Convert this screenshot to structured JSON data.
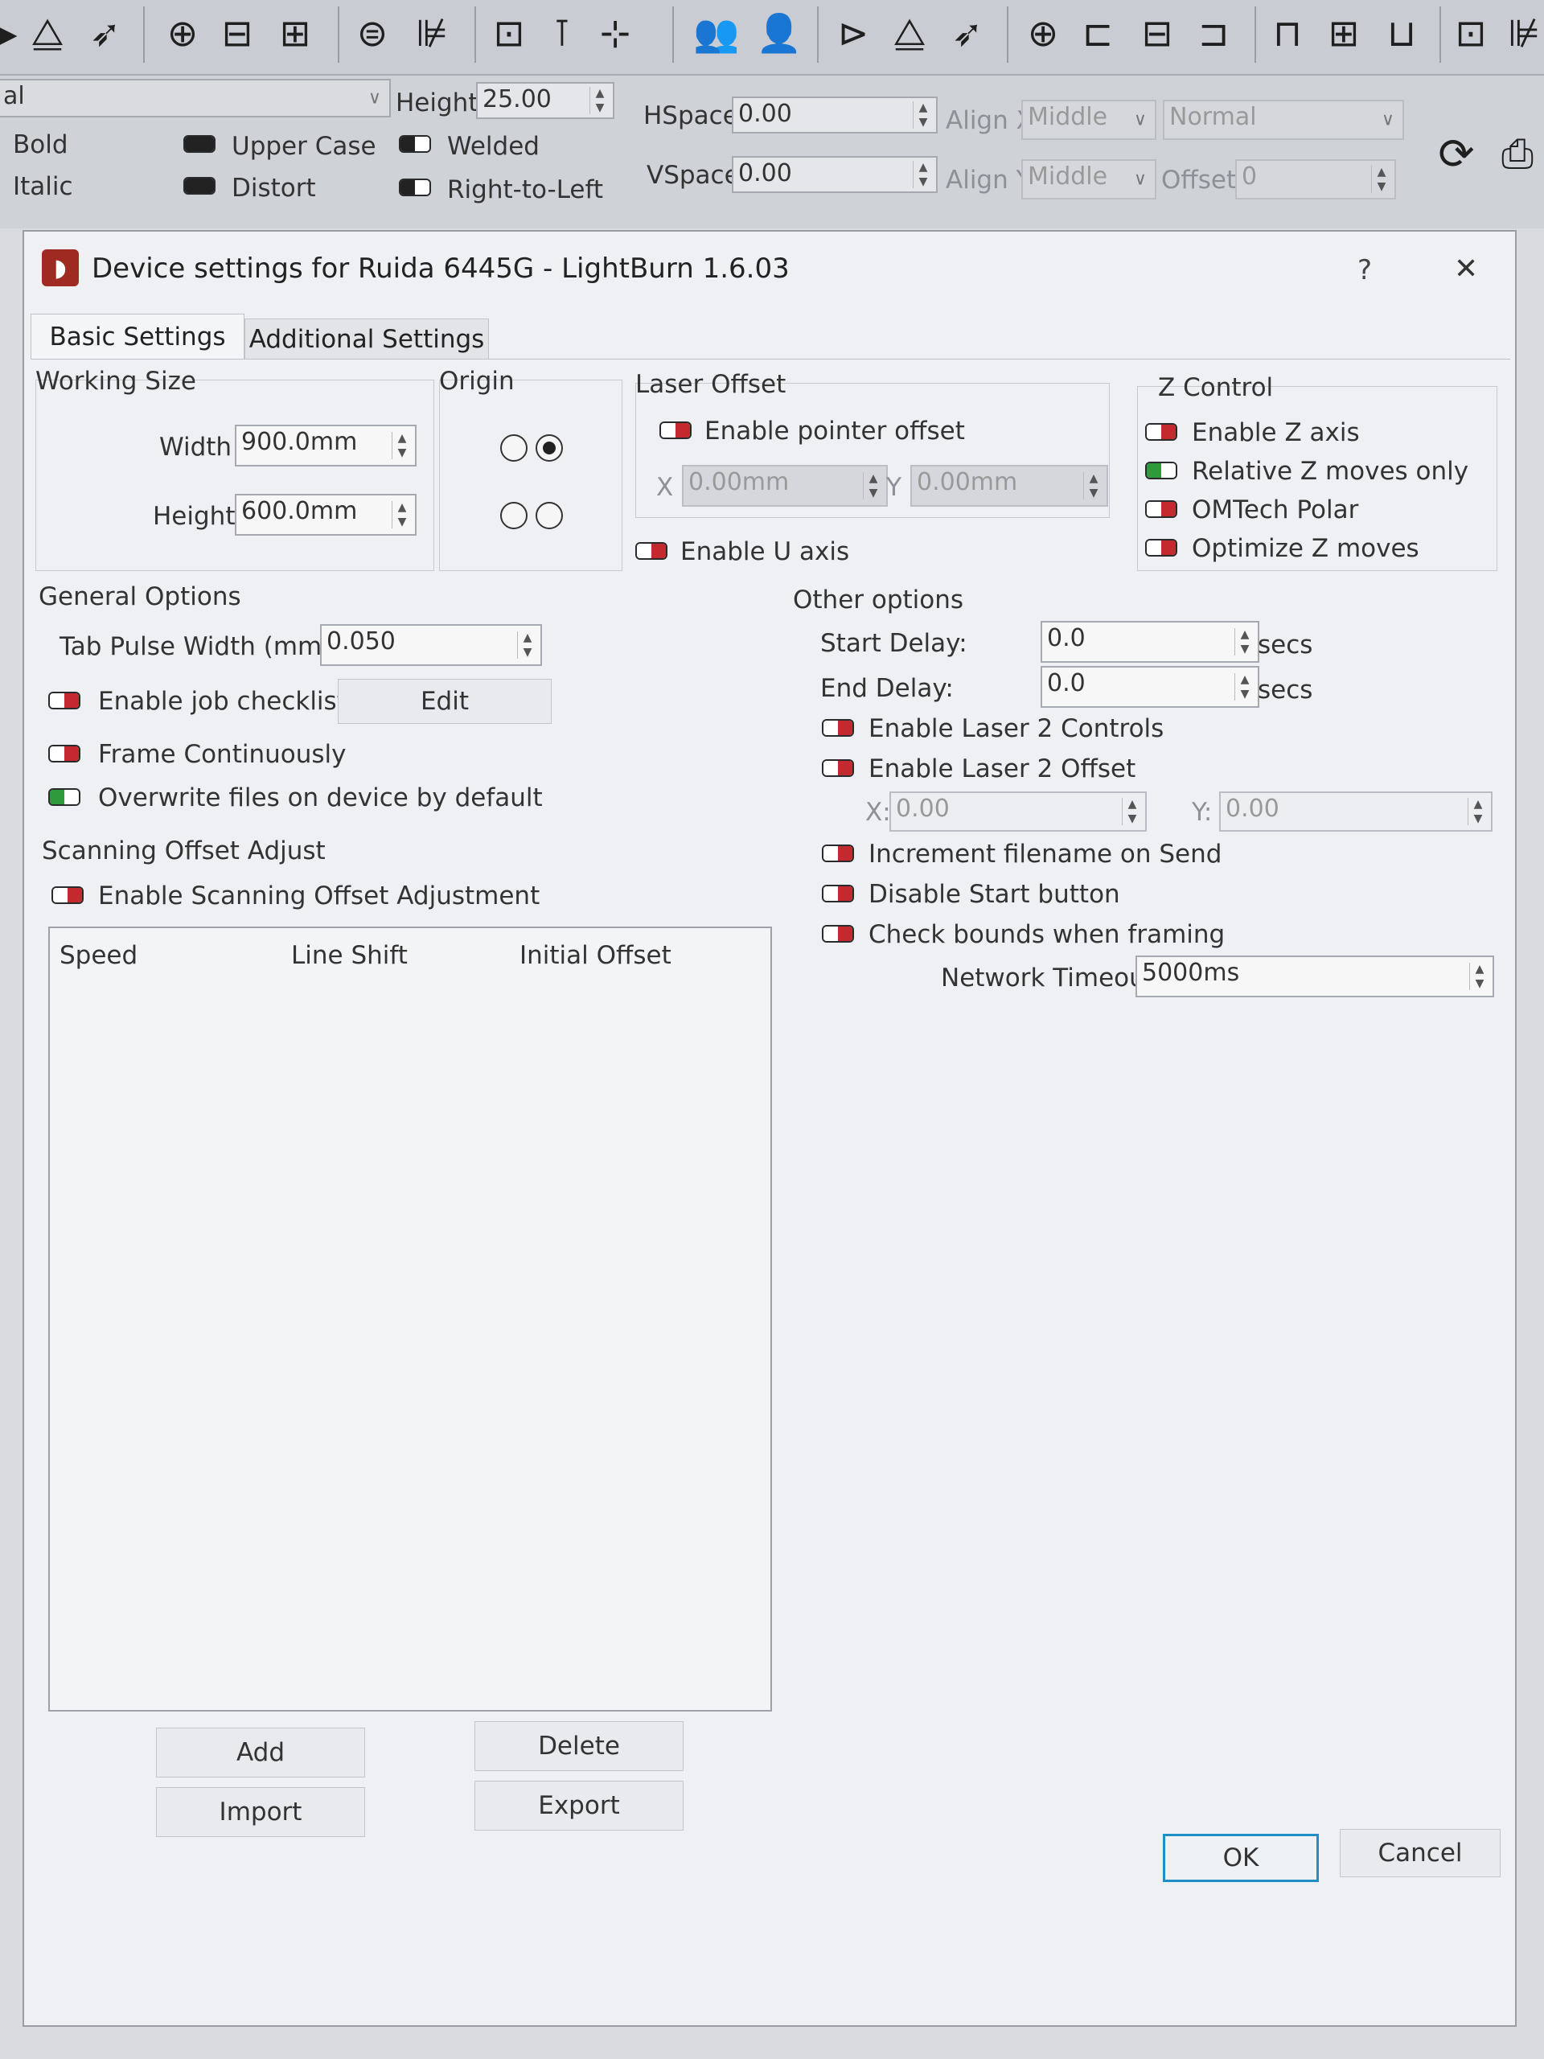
{
  "toolbar": {
    "icons": [
      "mirror-icon",
      "move-laser-icon",
      "target-icon",
      "align-centers-icon",
      "distribute-icon",
      "align-vertical-icon",
      "distribute-horizontal-icon",
      "group-icon",
      "distribute-spacing-icon",
      "add-node-icon",
      "users-icon",
      "user-icon",
      "arrow-right-icon",
      "mirror-icon",
      "move-laser-icon",
      "target-icon",
      "align-left-icon",
      "align-centers-icon",
      "align-right-icon",
      "align-top-icon",
      "align-middle-icon",
      "align-bottom-icon",
      "group-icon",
      "distribute-icon",
      "rotate-icon",
      "machine-icon"
    ]
  },
  "text_toolbar": {
    "font_partial": "al",
    "height_label": "Height",
    "height_value": "25.00",
    "hspace_label": "HSpace",
    "hspace_value": "0.00",
    "vspace_label": "VSpace",
    "vspace_value": "0.00",
    "align_x_label": "Align X",
    "align_x_value": "Middle",
    "align_y_label": "Align Y",
    "align_y_value": "Middle",
    "mode_value": "Normal",
    "offset_label": "Offset",
    "offset_value": "0",
    "bold": "Bold",
    "italic": "Italic",
    "upper_case": "Upper Case",
    "distort": "Distort",
    "welded": "Welded",
    "right_to_left": "Right-to-Left"
  },
  "dialog": {
    "title": "Device settings for Ruida 6445G - LightBurn 1.6.03",
    "help": "?",
    "close": "✕",
    "tabs": [
      "Basic Settings",
      "Additional Settings"
    ],
    "working_size": {
      "title": "Working Size",
      "width_label": "Width",
      "width_value": "900.0mm",
      "height_label": "Height",
      "height_value": "600.0mm"
    },
    "origin": {
      "title": "Origin",
      "selected": "top-right"
    },
    "laser_offset": {
      "title": "Laser Offset",
      "enable_pointer": "Enable pointer offset",
      "x_label": "X",
      "x_value": "0.00mm",
      "y_label": "Y",
      "y_value": "0.00mm",
      "enable_u_axis": "Enable U axis"
    },
    "z_control": {
      "title": "Z Control",
      "enable_z": "Enable Z axis",
      "relative_z": "Relative Z moves only",
      "omtech_polar": "OMTech Polar",
      "optimize_z": "Optimize Z moves"
    },
    "general": {
      "title": "General Options",
      "tab_pulse_label": "Tab Pulse Width (mm)",
      "tab_pulse_value": "0.050",
      "job_checklist": "Enable job checklist",
      "edit": "Edit",
      "frame_continuously": "Frame Continuously",
      "overwrite": "Overwrite files on device by default"
    },
    "scanning": {
      "title": "Scanning Offset Adjust",
      "enable": "Enable Scanning Offset Adjustment",
      "columns": [
        "Speed",
        "Line Shift",
        "Initial Offset"
      ],
      "add": "Add",
      "delete": "Delete",
      "import": "Import",
      "export": "Export"
    },
    "other": {
      "title": "Other options",
      "start_delay_label": "Start Delay:",
      "start_delay_value": "0.0",
      "end_delay_label": "End Delay:",
      "end_delay_value": "0.0",
      "secs": "secs",
      "laser2_controls": "Enable Laser 2 Controls",
      "laser2_offset": "Enable Laser 2 Offset",
      "x_label": "X:",
      "x_value": "0.00",
      "y_label": "Y:",
      "y_value": "0.00",
      "increment_filename": "Increment filename on Send",
      "disable_start": "Disable Start button",
      "check_bounds": "Check bounds when framing",
      "network_timeout_label": "Network Timeout",
      "network_timeout_value": "5000ms"
    },
    "ok": "OK",
    "cancel": "Cancel"
  }
}
